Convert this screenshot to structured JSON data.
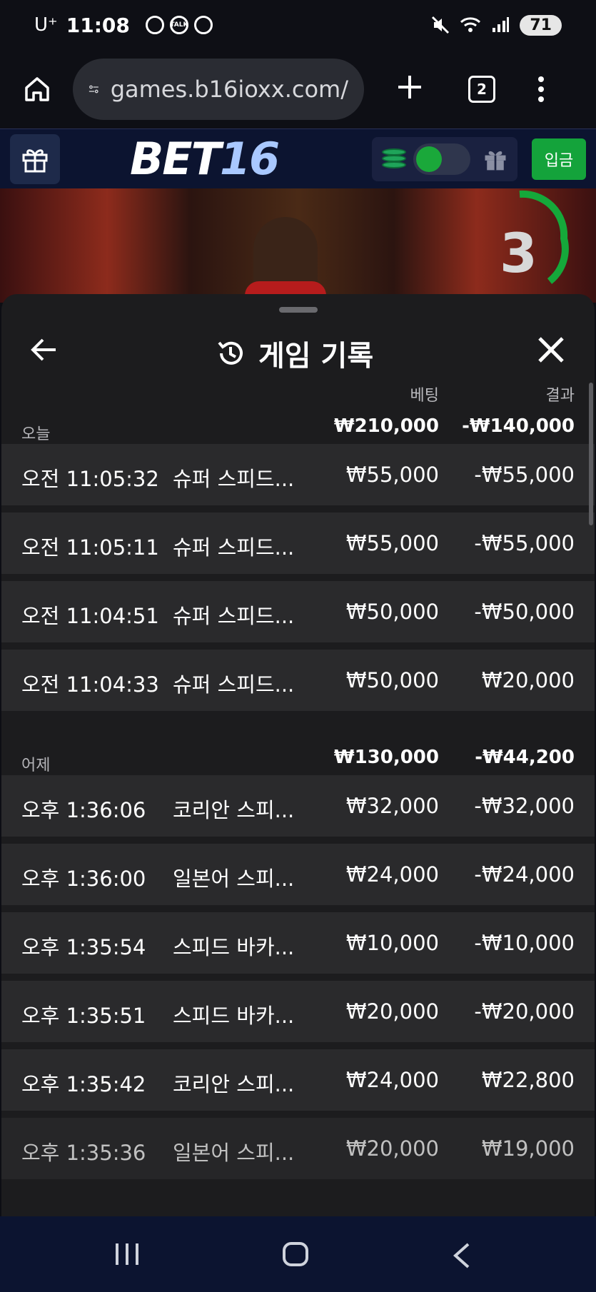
{
  "status_bar": {
    "carrier": "U⁺",
    "time": "11:08",
    "battery": "71",
    "talk_icon_label": "TALK"
  },
  "browser": {
    "url": "games.b16ioxx.com/",
    "tab_count": "2"
  },
  "site_header": {
    "logo_part1": "BET",
    "logo_part2": "16",
    "deposit_label": "입금"
  },
  "video": {
    "countdown": "3"
  },
  "history": {
    "title": "게임 기록",
    "col_bet": "베팅",
    "col_result": "결과",
    "groups": [
      {
        "label": "오늘",
        "bet_total": "₩210,000",
        "result_total": "-₩140,000",
        "rows": [
          {
            "time": "오전 11:05:32",
            "game": "슈퍼 스피드...",
            "bet": "₩55,000",
            "result": "-₩55,000"
          },
          {
            "time": "오전 11:05:11",
            "game": "슈퍼 스피드...",
            "bet": "₩55,000",
            "result": "-₩55,000"
          },
          {
            "time": "오전 11:04:51",
            "game": "슈퍼 스피드...",
            "bet": "₩50,000",
            "result": "-₩50,000"
          },
          {
            "time": "오전 11:04:33",
            "game": "슈퍼 스피드...",
            "bet": "₩50,000",
            "result": "₩20,000"
          }
        ]
      },
      {
        "label": "어제",
        "bet_total": "₩130,000",
        "result_total": "-₩44,200",
        "rows": [
          {
            "time": "오후 1:36:06",
            "game": "코리안 스피...",
            "bet": "₩32,000",
            "result": "-₩32,000"
          },
          {
            "time": "오후 1:36:00",
            "game": "일본어 스피...",
            "bet": "₩24,000",
            "result": "-₩24,000"
          },
          {
            "time": "오후 1:35:54",
            "game": "스피드 바카...",
            "bet": "₩10,000",
            "result": "-₩10,000"
          },
          {
            "time": "오후 1:35:51",
            "game": "스피드 바카...",
            "bet": "₩20,000",
            "result": "-₩20,000"
          },
          {
            "time": "오후 1:35:42",
            "game": "코리안 스피...",
            "bet": "₩24,000",
            "result": "₩22,800"
          },
          {
            "time": "오후 1:35:36",
            "game": "일본어 스피...",
            "bet": "₩20,000",
            "result": "₩19,000"
          }
        ]
      }
    ]
  }
}
